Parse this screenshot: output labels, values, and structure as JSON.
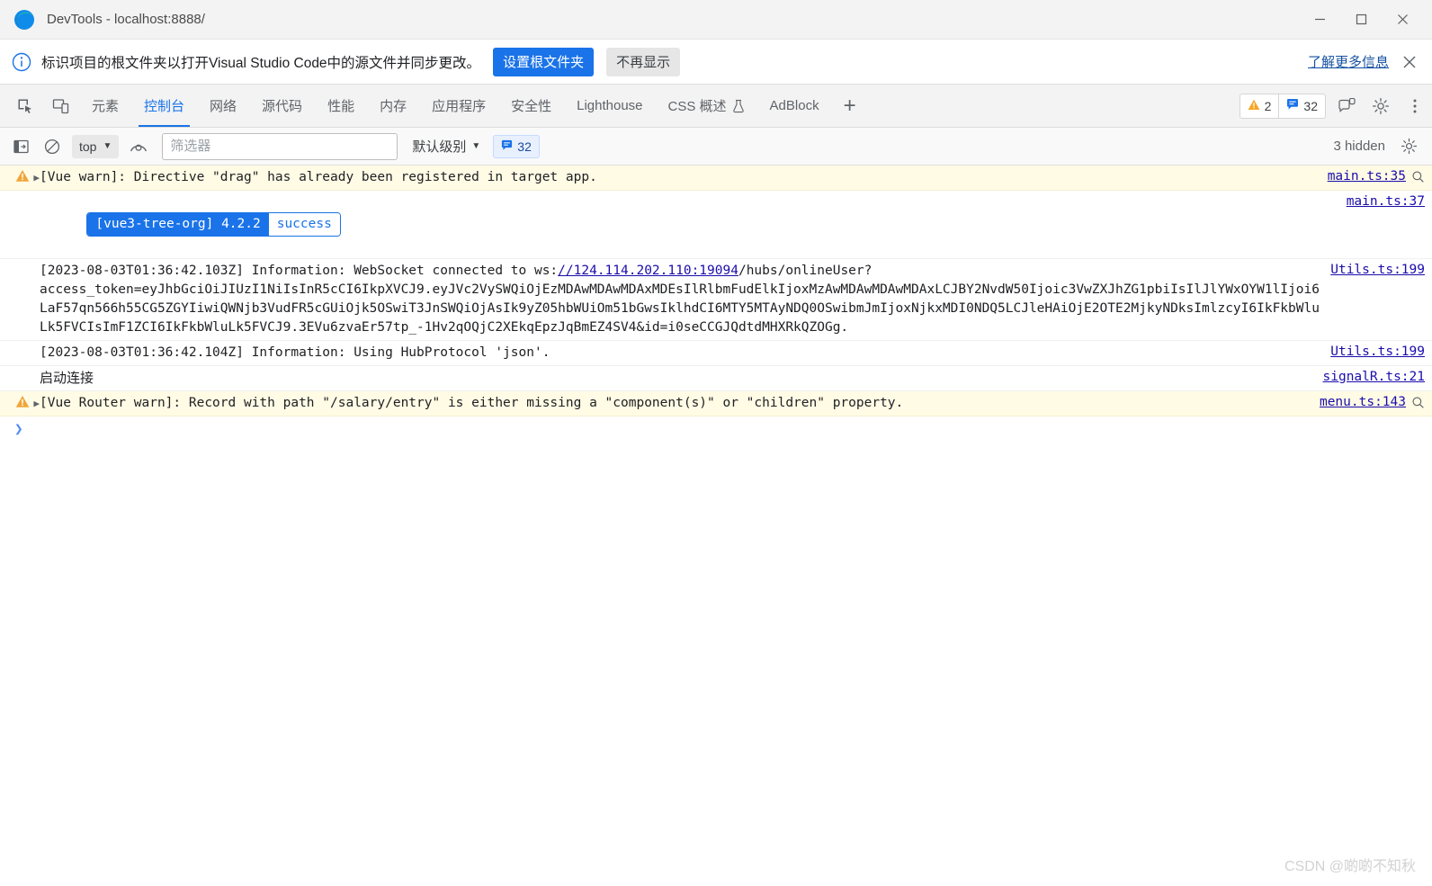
{
  "window": {
    "title": "DevTools - localhost:8888/",
    "minimize_label": "—",
    "maximize_label": "□",
    "close_label": "✕"
  },
  "banner": {
    "icon": "info-icon",
    "text": "标识项目的根文件夹以打开Visual Studio Code中的源文件并同步更改。",
    "primary_button": "设置根文件夹",
    "secondary_button": "不再显示",
    "link": "了解更多信息",
    "close": "✕"
  },
  "tabstrip": {
    "left_icons": [
      "inspect-element-icon",
      "device-toolbar-icon"
    ],
    "tabs": [
      {
        "label": "元素",
        "active": false
      },
      {
        "label": "控制台",
        "active": true
      },
      {
        "label": "网络",
        "active": false
      },
      {
        "label": "源代码",
        "active": false
      },
      {
        "label": "性能",
        "active": false
      },
      {
        "label": "内存",
        "active": false
      },
      {
        "label": "应用程序",
        "active": false
      },
      {
        "label": "安全性",
        "active": false
      },
      {
        "label": "Lighthouse",
        "active": false
      },
      {
        "label": "CSS 概述",
        "active": false,
        "icon": "flask-icon"
      },
      {
        "label": "AdBlock",
        "active": false
      }
    ],
    "add_tab": "+",
    "warning_count": "2",
    "message_count": "32",
    "right_icons": [
      "devices-icon",
      "settings-gear-icon",
      "more-options-icon"
    ]
  },
  "console_toolbar": {
    "sidebar_toggle": "console-sidebar-icon",
    "clear_console": "clear-console-icon",
    "context": "top",
    "live_expression": "eye-icon",
    "filter_placeholder": "筛选器",
    "filter_value": "",
    "level": "默认级别",
    "message_count": "32",
    "hidden_text": "3 hidden",
    "settings_icon": "settings-gear-icon"
  },
  "console": {
    "rows": [
      {
        "type": "warning",
        "expandable": true,
        "text": "[Vue warn]: Directive \"drag\" has already been registered in target app.",
        "source": "main.ts:35",
        "has_search_icon": true
      },
      {
        "type": "badge",
        "badge_left": "[vue3-tree-org] 4.2.2",
        "badge_right": "success",
        "source": "main.ts:37",
        "has_search_icon": false
      },
      {
        "type": "log",
        "text_before_link": "[2023-08-03T01:36:42.103Z] Information: WebSocket connected to ws:",
        "link": "//124.114.202.110:19094",
        "text_after_link": "/hubs/onlineUser?\naccess_token=eyJhbGciOiJIUzI1NiIsInR5cCI6IkpXVCJ9.eyJVc2VySWQiOjEzMDAwMDAwMDAxMDEsIlRlbmFudElkIjoxMzAwMDAwMDAwMDAxLCJBY2NvdW50Ijoic3VwZXJhZG1pbiIsIlJlYWxOYW1lIjoi6LaF57qn566h55CG5ZGYIiwiQWNjb3VudFR5cGUiOjk5OSwiT3JnSWQiOjAsIk9yZ05hbWUiOm51bGwsIklhdCI6MTY5MTAyNDQ0OSwibmJmIjoxNjkxMDI0NDQ5LCJleHAiOjE2OTE2MjkyNDksImlzcyI6IkFkbWluLk5FVCIsImF1ZCI6IkFkbWluLk5FVCJ9.3EVu6zvaEr57tp_-1Hv2qOQjC2XEkqEpzJqBmEZ4SV4&id=i0seCCGJQdtdMHXRkQZOGg.",
        "source": "Utils.ts:199",
        "has_search_icon": false
      },
      {
        "type": "log",
        "text": "[2023-08-03T01:36:42.104Z] Information: Using HubProtocol 'json'.",
        "source": "Utils.ts:199",
        "has_search_icon": false
      },
      {
        "type": "log-cjk",
        "text": "启动连接",
        "source": "signalR.ts:21",
        "has_search_icon": false
      },
      {
        "type": "warning",
        "expandable": true,
        "text": "[Vue Router warn]: Record with path \"/salary/entry\" is either missing a \"component(s)\" or \"children\" property.",
        "source": "menu.ts:143",
        "has_search_icon": true
      }
    ],
    "prompt_caret": "❯"
  },
  "watermark": "CSDN @啲啲不知秋"
}
